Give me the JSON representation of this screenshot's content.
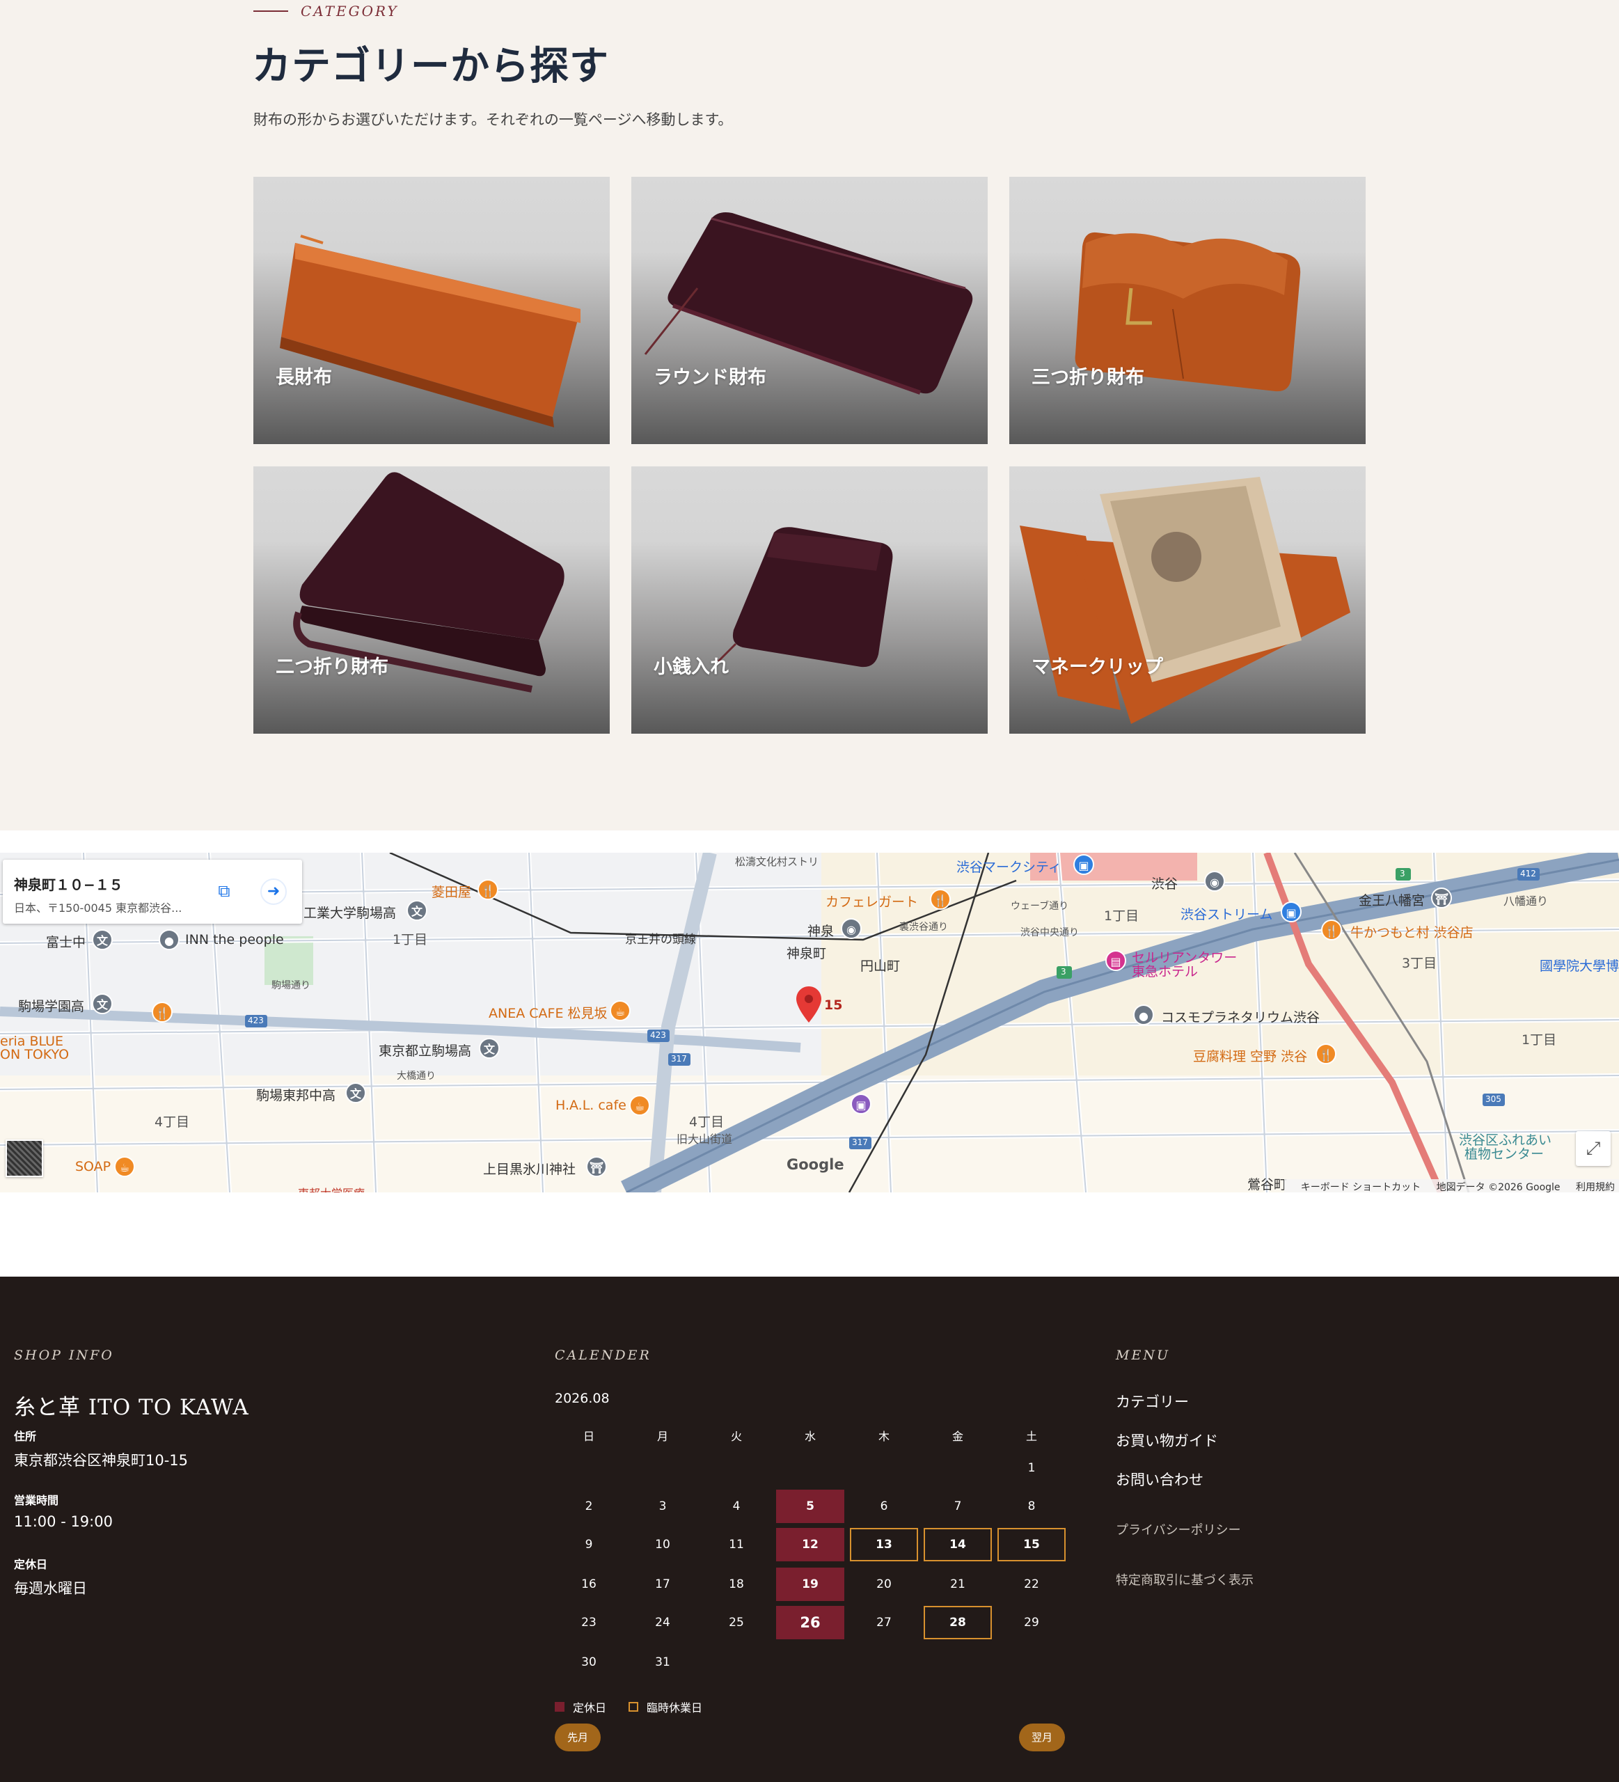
{
  "category": {
    "eyebrow": "CATEGORY",
    "title": "カテゴリーから探す",
    "description": "財布の形からお選びいただけます。それぞれの一覧ページへ移動します。",
    "cards": [
      {
        "label": "長財布",
        "color": "#c0561e"
      },
      {
        "label": "ラウンド財布",
        "color": "#3a1420"
      },
      {
        "label": "三つ折り財布",
        "color": "#b8531c"
      },
      {
        "label": "二つ折り財布",
        "color": "#3a1420"
      },
      {
        "label": "小銭入れ",
        "color": "#3a1420"
      },
      {
        "label": "マネークリップ",
        "color": "#c0561e"
      }
    ]
  },
  "map": {
    "place_title": "神泉町１０−１５",
    "place_address": "日本、〒150-0045 東京都渋谷...",
    "pin_label": "15",
    "google": "Google",
    "credits": {
      "shortcuts": "キーボード ショートカット",
      "data": "地図データ ©2026 Google",
      "terms": "利用規約"
    },
    "labels": {
      "hishidaya": "菱田屋",
      "kogyo": "工業大学駒場高",
      "tomigaya": "富士中",
      "inn": "INN the people",
      "chome1a": "1丁目",
      "komabagakuen": "駒場学園高",
      "eria1": "eria BLUE",
      "eria2": "ON TOKYO",
      "anea": "ANEA CAFE 松見坂",
      "toritsu": "東京都立駒場高",
      "toho": "駒場東邦中高",
      "chome4a": "4丁目",
      "soap": "SOAP",
      "hal": "H.A.L. cafe",
      "chome4b": "4丁目",
      "kyuoyama": "旧大山街道",
      "kamimeguro": "上目黒氷川神社",
      "keio": "京王井の頭線",
      "shinsen": "神泉",
      "shinsencho": "神泉町",
      "maruyama": "円山町",
      "cafe_legato": "カフェレガート",
      "mark_city": "渋谷マークシティ",
      "shibuya": "渋谷",
      "stream": "渋谷ストリーム",
      "cerulean1": "セルリアンタワー",
      "cerulean2": "東急ホテル",
      "cosmo": "コスモプラネタリウム渋谷",
      "tofu": "豆腐料理 空野 渋谷",
      "kanno": "金王八幡宮",
      "gyukatsu": "牛かつもと村 渋谷店",
      "kokugakuin": "國學院大學博",
      "chome1b": "1丁目",
      "chome3": "3丁目",
      "chome1c": "1丁目",
      "fureai1": "渋谷区ふれあい",
      "fureai2": "植物センター",
      "uguisudani": "鶯谷町",
      "hachiman": "八幡通り",
      "shoto": "松濤文化村ストリ",
      "komaba_dori": "駒場通り",
      "ura": "裏渋谷通り",
      "wave": "ウェーブ通り",
      "chuo": "渋谷中央通り",
      "ohashi": "大橋通り",
      "r423a": "423",
      "r423b": "423",
      "r317a": "317",
      "r317b": "317",
      "r412": "412",
      "r3a": "3",
      "r3b": "3",
      "r305": "305",
      "todai": "東邦大学医療"
    }
  },
  "footer": {
    "shop_info_head": "SHOP INFO",
    "shop_name": "糸と革 ITO TO KAWA",
    "address_label": "住所",
    "address": "東京都渋谷区神泉町10-15",
    "hours_label": "営業時間",
    "hours": "11:00 - 19:00",
    "closed_label": "定休日",
    "closed": "毎週水曜日",
    "calendar_head": "CALENDER",
    "calendar_month": "2026.08",
    "weekdays": [
      "日",
      "月",
      "火",
      "水",
      "木",
      "金",
      "土"
    ],
    "days": [
      "1",
      "2",
      "3",
      "4",
      "5",
      "6",
      "7",
      "8",
      "9",
      "10",
      "11",
      "12",
      "13",
      "14",
      "15",
      "16",
      "17",
      "18",
      "19",
      "20",
      "21",
      "22",
      "23",
      "24",
      "25",
      "26",
      "27",
      "28",
      "29",
      "30",
      "31"
    ],
    "legend_holiday": "定休日",
    "legend_temp": "臨時休業日",
    "prev": "先月",
    "next": "翌月",
    "menu_head": "MENU",
    "menu": [
      "カテゴリー",
      "お買い物ガイド",
      "お問い合わせ"
    ],
    "submenu": [
      "プライバシーポリシー",
      "特定商取引に基づく表示"
    ],
    "colors": {
      "background": "#221a18",
      "holiday": "#7a1f2e",
      "temp_border": "#d8912e",
      "button": "#a2661a"
    }
  }
}
